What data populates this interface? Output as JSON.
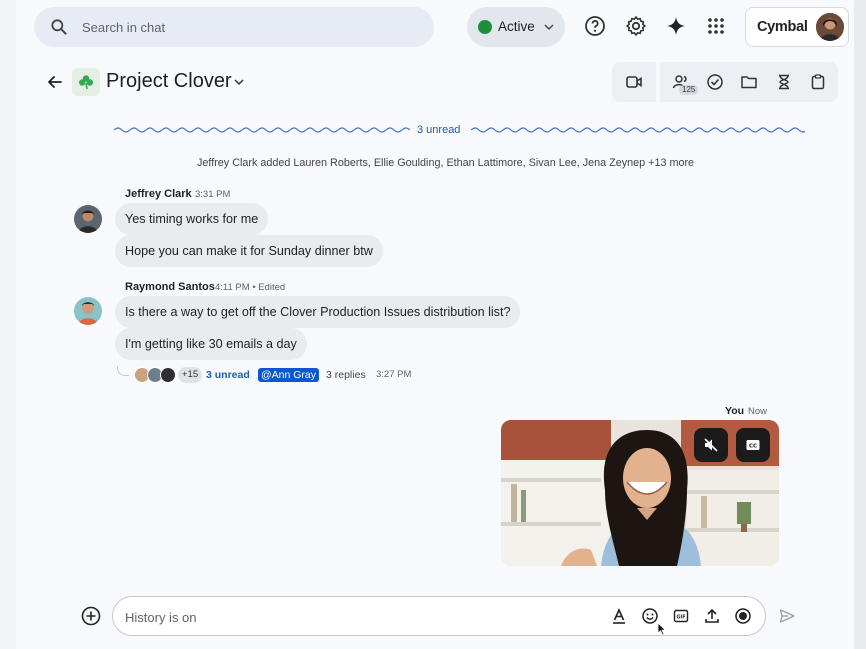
{
  "search": {
    "placeholder": "Search in chat",
    "icon": "search-icon"
  },
  "status": {
    "label": "Active",
    "color": "#1e8e3e"
  },
  "topbar": {
    "help_icon": "help-icon",
    "settings_icon": "gear-icon",
    "gemini_icon": "sparkle-icon",
    "apps_icon": "apps-grid-icon",
    "brand": "Cymbal"
  },
  "space": {
    "title": "Project Clover",
    "icon": "shamrock-icon",
    "members_count": "125"
  },
  "divider": {
    "label": "3 unread"
  },
  "system_message": "Jeffrey Clark added Lauren Roberts, Ellie Goulding, Ethan Lattimore, Sivan Lee, Jena Zeynep +13 more",
  "messages": [
    {
      "sender": "Jeffrey Clark",
      "meta": "3:31 PM",
      "bubbles": [
        "Yes timing works for me",
        "Hope you can make it for Sunday dinner btw"
      ]
    },
    {
      "sender": "Raymond Santos",
      "meta": "4:11 PM • Edited",
      "bubbles": [
        "Is there a way to get off the Clover Production Issues distribution list?",
        "I'm getting like 30 emails a day"
      ]
    }
  ],
  "thread": {
    "more": "+15",
    "unread": "3 unread",
    "mention": "@Ann Gray",
    "replies": "3 replies",
    "time": "3:27 PM"
  },
  "self": {
    "sender": "You",
    "time": "Now"
  },
  "composer": {
    "placeholder": "History is on"
  },
  "colors": {
    "accent": "#0b57d0",
    "bubble": "#e9ebef",
    "unread": "#1a5fb4"
  }
}
